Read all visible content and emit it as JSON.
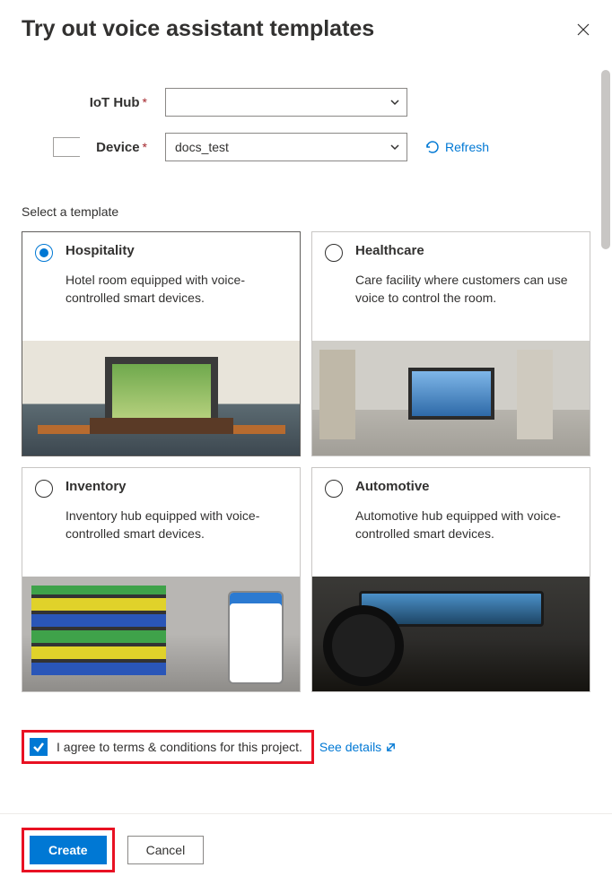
{
  "header": {
    "title": "Try out voice assistant templates"
  },
  "form": {
    "iot_hub_label": "IoT Hub",
    "iot_hub_value": "",
    "device_label": "Device",
    "device_value": "docs_test",
    "refresh_label": "Refresh"
  },
  "section": {
    "select_template_label": "Select a template"
  },
  "templates": [
    {
      "id": "hospitality",
      "title": "Hospitality",
      "desc": "Hotel room equipped with voice-controlled smart devices.",
      "selected": true
    },
    {
      "id": "healthcare",
      "title": "Healthcare",
      "desc": "Care facility where customers can use voice to control the room.",
      "selected": false
    },
    {
      "id": "inventory",
      "title": "Inventory",
      "desc": "Inventory hub equipped with voice-controlled smart devices.",
      "selected": false
    },
    {
      "id": "automotive",
      "title": "Automotive",
      "desc": "Automotive hub equipped with voice-controlled smart devices.",
      "selected": false
    }
  ],
  "terms": {
    "checked": true,
    "text": "I agree to terms & conditions for this project.",
    "see_details_label": "See details"
  },
  "footer": {
    "create_label": "Create",
    "cancel_label": "Cancel"
  }
}
